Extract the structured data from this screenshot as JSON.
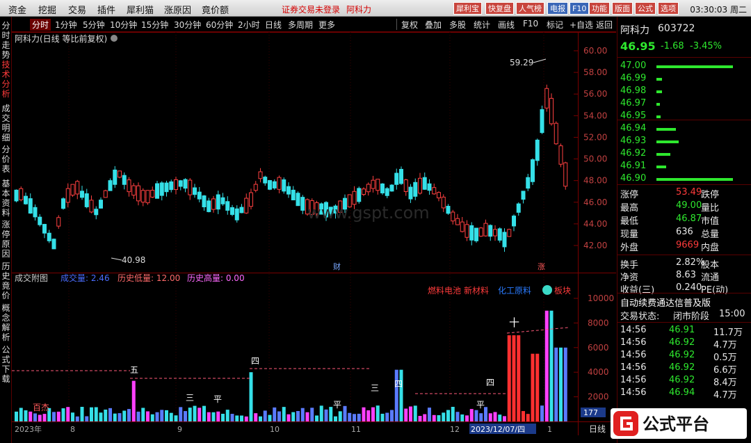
{
  "menubar": {
    "items": [
      "资金",
      "挖掘",
      "交易",
      "插件",
      "犀利猫",
      "涨原因",
      "竟价额"
    ],
    "notice": "证券交易未登录",
    "stock_name": "阿科力",
    "right_buttons": [
      "犀利宝",
      "快复盘",
      "人气榜",
      "电报",
      "F10",
      "功能",
      "版面",
      "公式",
      "选项"
    ],
    "clock": "03:30:03 周二"
  },
  "leftnav": [
    "分时走势",
    "技术分析",
    "成交明细",
    "分价表",
    "基本资料",
    "涨停原因",
    "历史竟价",
    "概念解析",
    "公式下载"
  ],
  "period": {
    "items": [
      "分时",
      "1分钟",
      "5分钟",
      "10分钟",
      "15分钟",
      "30分钟",
      "60分钟",
      "2小时",
      "日线",
      "多周期",
      "更多"
    ],
    "active": "分时",
    "tools": [
      "复权",
      "叠加",
      "多股",
      "统计",
      "画线",
      "F10",
      "标记",
      "+自选",
      "返回"
    ]
  },
  "chart": {
    "title": "阿科力(日线 等比前复权)",
    "high_label": "59.29",
    "low_label": "40.98",
    "marker_cai": "财",
    "marker_zhang": "涨",
    "y_labels": [
      "60.00",
      "58.00",
      "56.00",
      "54.00",
      "52.00",
      "50.00",
      "48.00",
      "46.00",
      "44.00",
      "42.00"
    ],
    "watermark": "www.gspt.com"
  },
  "sub": {
    "title": "成交附图",
    "vol_label": "成交量: 2.46",
    "hist_low": "历史低量: 12.00",
    "hist_high": "历史高量: 0.00",
    "concepts": [
      "燃料电池",
      "新材料",
      "化工原料",
      "板块"
    ],
    "y_labels": [
      "10000",
      "8000",
      "6000",
      "4000",
      "2000"
    ],
    "bottom_value": "177",
    "period_tag": "日线",
    "x_labels": [
      "2023年",
      "8",
      "9",
      "10",
      "11",
      "12",
      "2023/12/07/四",
      "1"
    ],
    "marks": [
      "五",
      "三",
      "平",
      "四",
      "三",
      "四",
      "平",
      "平",
      "四",
      "十",
      "百杰",
      "31",
      "21",
      "32"
    ]
  },
  "quote": {
    "name": "阿科力",
    "code": "603722",
    "price": "46.95",
    "change": "-1.68",
    "pct": "-3.45%",
    "asks": [
      {
        "p": "47.00"
      },
      {
        "p": "46.99"
      },
      {
        "p": "46.98"
      },
      {
        "p": "46.97"
      },
      {
        "p": "46.95"
      }
    ],
    "bids": [
      {
        "p": "46.94"
      },
      {
        "p": "46.93"
      },
      {
        "p": "46.92"
      },
      {
        "p": "46.91"
      },
      {
        "p": "46.90"
      }
    ],
    "stats": [
      {
        "k": "涨停",
        "v": "53.49",
        "k2": "跌停"
      },
      {
        "k": "最高",
        "v": "49.00",
        "k2": "量比"
      },
      {
        "k": "最低",
        "v": "46.87",
        "k2": "市值"
      },
      {
        "k": "现量",
        "v": "636",
        "k2": "总量"
      },
      {
        "k": "外盘",
        "v": "9669",
        "k2": "内盘"
      }
    ],
    "stats2": [
      {
        "k": "换手",
        "v": "2.82%",
        "k2": "股本"
      },
      {
        "k": "净资",
        "v": "8.63",
        "k2": "流通"
      },
      {
        "k": "收益(三)",
        "v": "0.240",
        "k2": "PE(动)"
      }
    ],
    "banner": "自动续费通达信普及版",
    "status_label": "交易状态:",
    "status_value": "闭市阶段",
    "status_time": "15:00",
    "ticks": [
      {
        "t": "14:56",
        "p": "46.91",
        "v": "11.7万"
      },
      {
        "t": "14:56",
        "p": "46.92",
        "v": "4.7万"
      },
      {
        "t": "14:56",
        "p": "46.92",
        "v": "0.5万"
      },
      {
        "t": "14:56",
        "p": "46.92",
        "v": "6.6万"
      },
      {
        "t": "14:56",
        "p": "46.92",
        "v": "8.4万"
      },
      {
        "t": "14:56",
        "p": "46.94",
        "v": "4.7万"
      }
    ],
    "logo_text": "公式平台",
    "logo_sub": "www.gspt.com"
  }
}
